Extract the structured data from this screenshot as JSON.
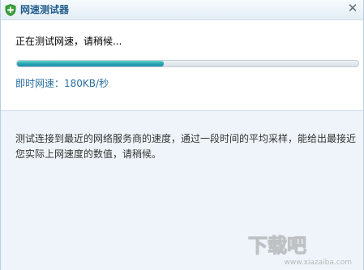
{
  "window": {
    "title": "网速测试器",
    "close_glyph": "✕"
  },
  "status": {
    "text": "正在测试网速，请稍候..."
  },
  "progress": {
    "fraction": 0.43
  },
  "speed": {
    "label": "即时网速：",
    "value": "180KB/秒"
  },
  "info": {
    "text": "测试连接到最近的网络服务商的速度，通过一段时间的平均采样，能给出最接近您实际上网速度的数值，请稍候。"
  },
  "watermark": {
    "logo_text": "下载吧",
    "url": "www.xiazaiba.com"
  },
  "colors": {
    "title": "#1f5d8e",
    "speed": "#2a6ea0",
    "progress_fill": "#2aa3b3",
    "panel": "#eef4f9"
  },
  "icons": {
    "app": "shield-plus-icon",
    "close": "close-icon"
  }
}
